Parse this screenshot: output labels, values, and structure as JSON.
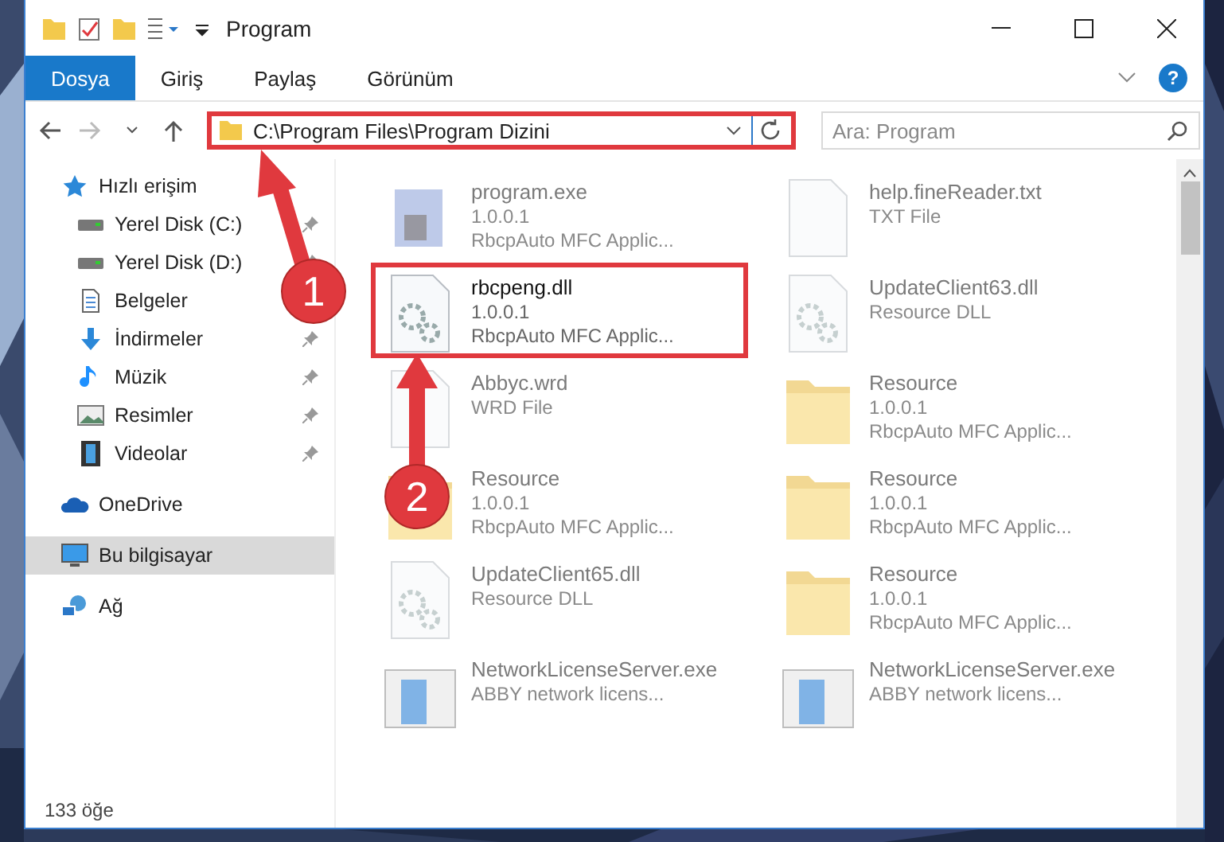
{
  "window": {
    "title": "Program"
  },
  "ribbon": {
    "tabs": [
      {
        "label": "Dosya",
        "selected": true
      },
      {
        "label": "Giriş",
        "selected": false
      },
      {
        "label": "Paylaş",
        "selected": false
      },
      {
        "label": "Görünüm",
        "selected": false
      }
    ],
    "help": "?"
  },
  "address": {
    "path": "C:\\Program Files\\Program Dizini",
    "highlighted": true
  },
  "search": {
    "placeholder": "Ara: Program"
  },
  "sidebar": {
    "items": [
      {
        "label": "Hızlı erişim",
        "kind": "star",
        "selected": false,
        "children": [
          {
            "label": "Yerel Disk (C:)",
            "kind": "drive",
            "pinned": true,
            "selected": false
          },
          {
            "label": "Yerel Disk (D:)",
            "kind": "drive",
            "pinned": true,
            "selected": false
          },
          {
            "label": "Belgeler",
            "kind": "doc",
            "selected": false
          },
          {
            "label": "İndirmeler",
            "kind": "download",
            "pinned": true,
            "selected": false
          },
          {
            "label": "Müzik",
            "kind": "music",
            "pinned": true,
            "selected": false
          },
          {
            "label": "Resimler",
            "pinned": true,
            "selected": false
          },
          {
            "label": "Videolar",
            "kind": "film",
            "pinned": true,
            "selected": false
          }
        ]
      },
      {
        "label": "OneDrive",
        "kind": "cloud",
        "selected": false
      },
      {
        "label": "Bu bilgisayar",
        "kind": "pc",
        "selected": true
      },
      {
        "label": "Ağ",
        "kind": "network",
        "selected": false
      }
    ]
  },
  "files": [
    {
      "name": "program.exe",
      "lines": [
        "1.0.0.1",
        "RbcpAuto MFC Applic..."
      ],
      "kind": "app",
      "dimmed": true,
      "highlighted": false
    },
    {
      "name": "help.fineReader.txt",
      "lines": [
        "TXT File"
      ],
      "kind": "blank",
      "dimmed": true,
      "highlighted": false
    },
    {
      "name": "rbcpeng.dll",
      "lines": [
        "1.0.0.1",
        "RbcpAuto MFC Applic..."
      ],
      "kind": "dll",
      "dimmed": false,
      "highlighted": true
    },
    {
      "name": "UpdateClient63.dll",
      "lines": [
        "Resource DLL"
      ],
      "kind": "dll",
      "dimmed": true,
      "highlighted": false
    },
    {
      "name": "Abbyc.wrd",
      "lines": [
        "WRD File"
      ],
      "kind": "blank",
      "dimmed": true,
      "highlighted": false
    },
    {
      "name": "Resource",
      "lines": [
        "1.0.0.1",
        "RbcpAuto MFC Applic..."
      ],
      "kind": "folder",
      "dimmed": true,
      "highlighted": false
    },
    {
      "name": "Resource",
      "lines": [
        "1.0.0.1",
        "RbcpAuto MFC Applic..."
      ],
      "kind": "folder",
      "dimmed": true,
      "highlighted": false
    },
    {
      "name": "Resource",
      "lines": [
        "1.0.0.1",
        "RbcpAuto MFC Applic..."
      ],
      "kind": "folder",
      "dimmed": true,
      "highlighted": false
    },
    {
      "name": "UpdateClient65.dll",
      "lines": [
        "Resource DLL"
      ],
      "kind": "dll",
      "dimmed": true,
      "highlighted": false
    },
    {
      "name": "Resource",
      "lines": [
        "1.0.0.1",
        "RbcpAuto MFC Applic..."
      ],
      "kind": "folder",
      "dimmed": true,
      "highlighted": false
    },
    {
      "name": "NetworkLicenseServer.exe",
      "lines": [
        "ABBY network licens..."
      ],
      "kind": "window-app",
      "dimmed": true,
      "highlighted": false
    },
    {
      "name": "NetworkLicenseServer.exe",
      "lines": [
        "ABBY network licens..."
      ],
      "kind": "window-app",
      "dimmed": true,
      "highlighted": false
    }
  ],
  "status_bar": {
    "count": "133 öğe"
  },
  "annotations": [
    {
      "label": "1"
    },
    {
      "label": "2"
    }
  ]
}
